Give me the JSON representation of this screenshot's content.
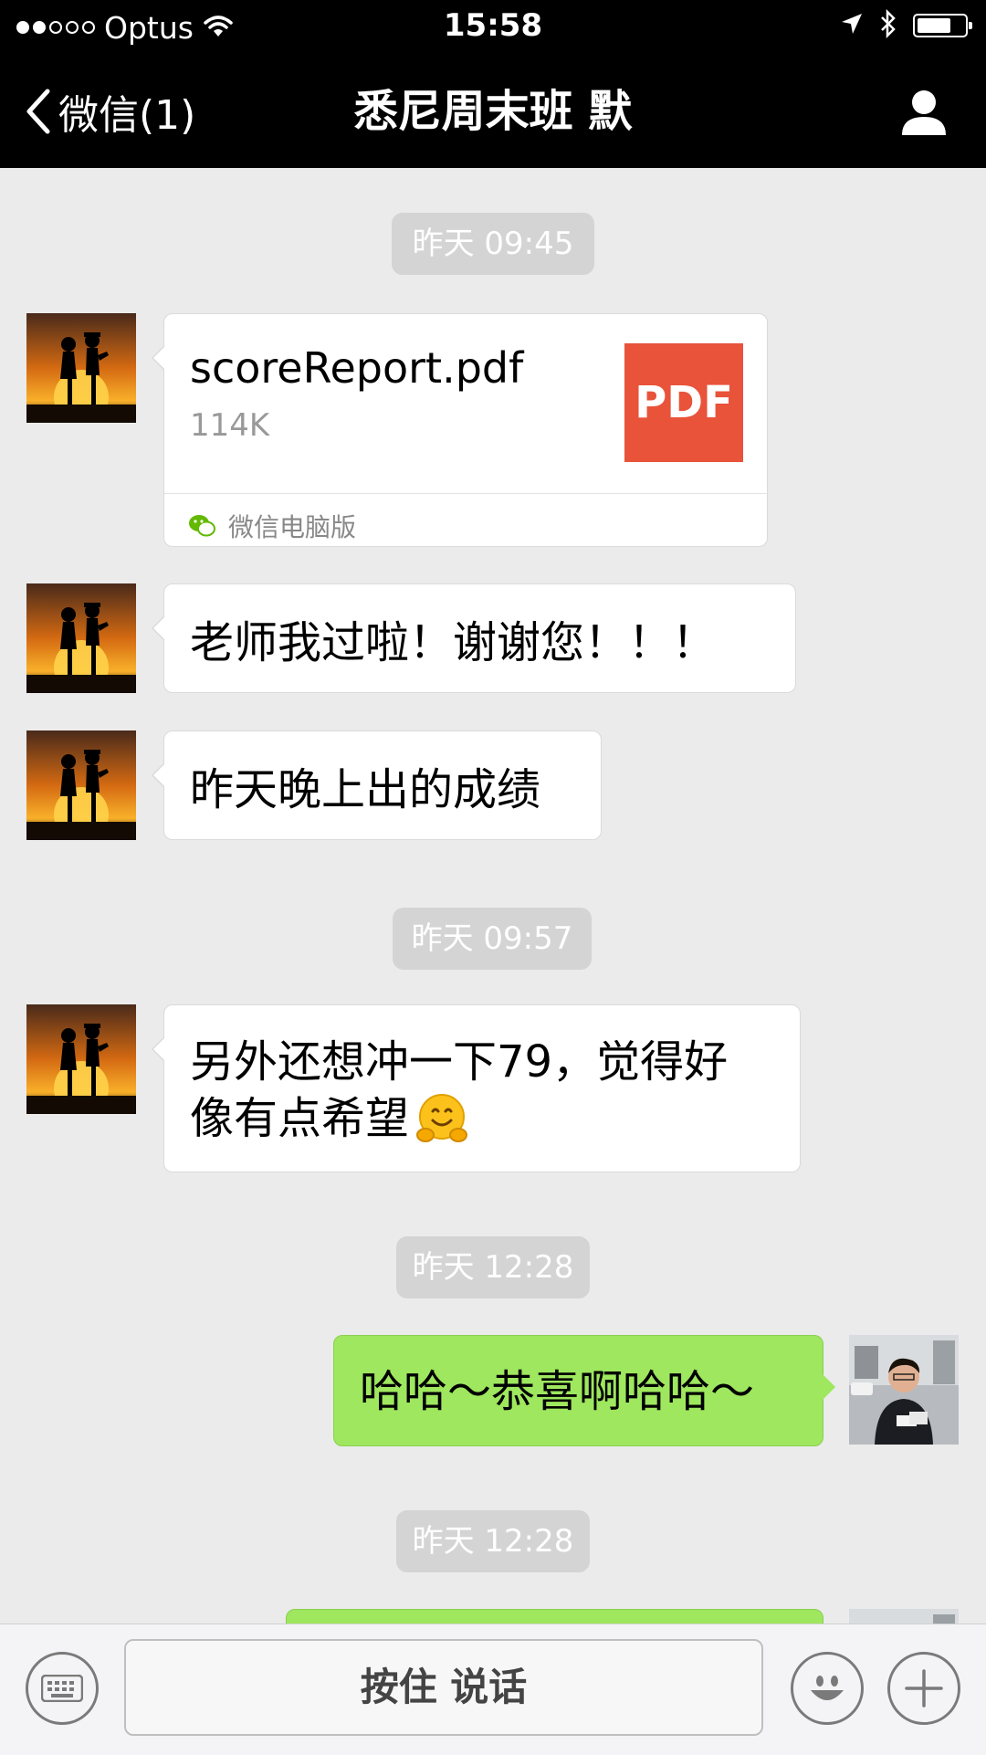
{
  "status_bar": {
    "carrier": "Optus",
    "time": "15:58"
  },
  "nav": {
    "back_label": "微信(1)",
    "title": "悉尼周末班 默"
  },
  "messages": {
    "ts1": "昨天 09:45",
    "file": {
      "name": "scoreReport.pdf",
      "size": "114K",
      "badge": "PDF",
      "source": "微信电脑版"
    },
    "msg2": "老师我过啦！谢谢您！！！",
    "msg3": "昨天晚上出的成绩",
    "ts2": "昨天 09:57",
    "msg4_line1": "另外还想冲一下79，觉得好",
    "msg4_line2": "像有点希望",
    "ts3": "昨天 12:28",
    "msg5": "哈哈～恭喜啊哈哈～",
    "ts4": "昨天 12:28"
  },
  "input_bar": {
    "voice_label": "按住 说话"
  },
  "colors": {
    "outgoing_bubble": "#9ee75e",
    "pdf_badge": "#e8533a",
    "nav_bg": "#000000",
    "chat_bg": "#ebebeb"
  },
  "icons": {
    "signal": "signal-dots-icon",
    "wifi": "wifi-icon",
    "location": "location-arrow-icon",
    "bluetooth": "bluetooth-icon",
    "battery": "battery-icon",
    "back": "chevron-left-icon",
    "profile": "profile-icon",
    "keyboard": "keyboard-icon",
    "emoji": "emoji-icon",
    "plus": "plus-icon"
  }
}
